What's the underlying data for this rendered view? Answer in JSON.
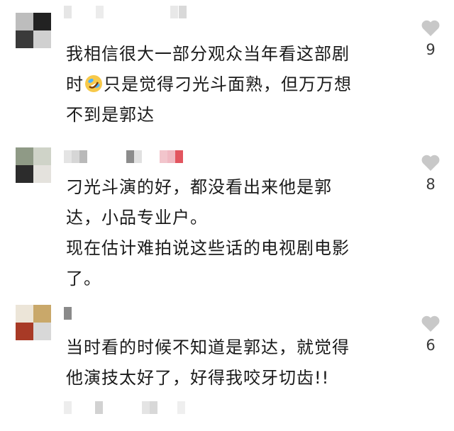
{
  "comments": [
    {
      "lines": [
        "我相信很大一部分观众当年看这部剧",
        "时",
        "只是觉得刁光斗面熟，但万万想",
        "不到是郭达"
      ],
      "likes": "9",
      "emoji": "rolling-on-floor-laughing-emoji"
    },
    {
      "lines": [
        "刁光斗演的好，都没看出来他是郭",
        "达，小品专业户。",
        "现在估计难拍说这些话的电视剧电影",
        "了。"
      ],
      "likes": "8"
    },
    {
      "lines": [
        "当时看的时候不知道是郭达，就觉得",
        "他演技太好了，好得我咬牙切齿!!"
      ],
      "likes": "6"
    }
  ],
  "colors": {
    "heart": "#c8c8c8",
    "text": "#1a1a1a",
    "count": "#3a3a3a"
  }
}
